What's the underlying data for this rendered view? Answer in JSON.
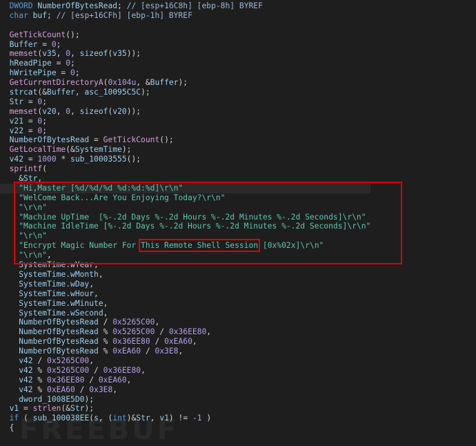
{
  "colors": {
    "background": "#1e1e1e",
    "keyword": "#569cd6",
    "variable": "#9cd0f0",
    "function": "#d8a0dc",
    "number": "#b5a0e8",
    "string": "#5ec8b0",
    "highlight_box": "#e00000"
  },
  "watermark": "FREEBUF",
  "current_line": 19,
  "lines": [
    [
      [
        "t",
        "  DWORD"
      ],
      [
        "o",
        " "
      ],
      [
        "v",
        "NumberOfBytesRead"
      ],
      [
        "o",
        "; "
      ],
      [
        "c",
        "// [esp+16C8h] [ebp-8h] BYREF"
      ]
    ],
    [
      [
        "t",
        "  char"
      ],
      [
        "o",
        " "
      ],
      [
        "v",
        "buf"
      ],
      [
        "o",
        "; "
      ],
      [
        "c",
        "// [esp+16CFh] [ebp-1h] BYREF"
      ]
    ],
    [],
    [
      [
        "f",
        "  GetTickCount"
      ],
      [
        "o",
        "();"
      ]
    ],
    [
      [
        "v",
        "  Buffer"
      ],
      [
        "o",
        " = "
      ],
      [
        "n",
        "0"
      ],
      [
        "o",
        ";"
      ]
    ],
    [
      [
        "f",
        "  memset"
      ],
      [
        "o",
        "("
      ],
      [
        "v",
        "v35"
      ],
      [
        "o",
        ", "
      ],
      [
        "n",
        "0"
      ],
      [
        "o",
        ", "
      ],
      [
        "v",
        "sizeof"
      ],
      [
        "o",
        "("
      ],
      [
        "v",
        "v35"
      ],
      [
        "o",
        "));"
      ]
    ],
    [
      [
        "v",
        "  hReadPipe"
      ],
      [
        "o",
        " = "
      ],
      [
        "n",
        "0"
      ],
      [
        "o",
        ";"
      ]
    ],
    [
      [
        "v",
        "  hWritePipe"
      ],
      [
        "o",
        " = "
      ],
      [
        "n",
        "0"
      ],
      [
        "o",
        ";"
      ]
    ],
    [
      [
        "f",
        "  GetCurrentDirectoryA"
      ],
      [
        "o",
        "("
      ],
      [
        "n",
        "0x104u"
      ],
      [
        "o",
        ", &"
      ],
      [
        "v",
        "Buffer"
      ],
      [
        "o",
        ");"
      ]
    ],
    [
      [
        "v",
        "  strcat"
      ],
      [
        "o",
        "(&"
      ],
      [
        "v",
        "Buffer"
      ],
      [
        "o",
        ", "
      ],
      [
        "v",
        "asc_10095C5C"
      ],
      [
        "o",
        ");"
      ]
    ],
    [
      [
        "v",
        "  Str"
      ],
      [
        "o",
        " = "
      ],
      [
        "n",
        "0"
      ],
      [
        "o",
        ";"
      ]
    ],
    [
      [
        "f",
        "  memset"
      ],
      [
        "o",
        "("
      ],
      [
        "v",
        "v20"
      ],
      [
        "o",
        ", "
      ],
      [
        "n",
        "0"
      ],
      [
        "o",
        ", "
      ],
      [
        "v",
        "sizeof"
      ],
      [
        "o",
        "("
      ],
      [
        "v",
        "v20"
      ],
      [
        "o",
        "));"
      ]
    ],
    [
      [
        "v",
        "  v21"
      ],
      [
        "o",
        " = "
      ],
      [
        "n",
        "0"
      ],
      [
        "o",
        ";"
      ]
    ],
    [
      [
        "v",
        "  v22"
      ],
      [
        "o",
        " = "
      ],
      [
        "n",
        "0"
      ],
      [
        "o",
        ";"
      ]
    ],
    [
      [
        "v",
        "  NumberOfBytesRead"
      ],
      [
        "o",
        " = "
      ],
      [
        "f",
        "GetTickCount"
      ],
      [
        "o",
        "();"
      ]
    ],
    [
      [
        "f",
        "  GetLocalTime"
      ],
      [
        "o",
        "(&"
      ],
      [
        "v",
        "SystemTime"
      ],
      [
        "o",
        ");"
      ]
    ],
    [
      [
        "v",
        "  v42"
      ],
      [
        "o",
        " = "
      ],
      [
        "n",
        "1000"
      ],
      [
        "o",
        " * "
      ],
      [
        "v",
        "sub_10003555"
      ],
      [
        "o",
        "();"
      ]
    ],
    [
      [
        "f",
        "  sprintf"
      ],
      [
        "o",
        "("
      ]
    ],
    [
      [
        "o",
        "    &"
      ],
      [
        "v",
        "Str"
      ],
      [
        "o",
        ","
      ]
    ],
    [
      [
        "s",
        "    \"Hi,Master [%d/%d/%d %d:%d:%d]\\r\\n\""
      ]
    ],
    [
      [
        "s",
        "    \"WelCome Back...Are You Enjoying Today?\\r\\n\""
      ]
    ],
    [
      [
        "s",
        "    \"\\r\\n\""
      ]
    ],
    [
      [
        "s",
        "    \"Machine UpTime  [%-.2d Days %-.2d Hours %-.2d Minutes %-.2d Seconds]\\r\\n\""
      ]
    ],
    [
      [
        "s",
        "    \"Machine IdleTime [%-.2d Days %-.2d Hours %-.2d Minutes %-.2d Seconds]\\r\\n\""
      ]
    ],
    [
      [
        "s",
        "    \"\\r\\n\""
      ]
    ],
    [
      [
        "s",
        "    \"Encrypt Magic Number For "
      ],
      [
        "hl",
        "This Remote Shell Session"
      ],
      [
        "s",
        " [0x%02x]\\r\\n\""
      ]
    ],
    [
      [
        "s",
        "    \"\\r\\n\""
      ],
      [
        "o",
        ","
      ]
    ],
    [
      [
        "v",
        "    SystemTime.wYear"
      ],
      [
        "o",
        ","
      ]
    ],
    [
      [
        "v",
        "    SystemTime.wMonth"
      ],
      [
        "o",
        ","
      ]
    ],
    [
      [
        "v",
        "    SystemTime.wDay"
      ],
      [
        "o",
        ","
      ]
    ],
    [
      [
        "v",
        "    SystemTime.wHour"
      ],
      [
        "o",
        ","
      ]
    ],
    [
      [
        "v",
        "    SystemTime.wMinute"
      ],
      [
        "o",
        ","
      ]
    ],
    [
      [
        "v",
        "    SystemTime.wSecond"
      ],
      [
        "o",
        ","
      ]
    ],
    [
      [
        "v",
        "    NumberOfBytesRead"
      ],
      [
        "o",
        " / "
      ],
      [
        "n",
        "0x5265C00"
      ],
      [
        "o",
        ","
      ]
    ],
    [
      [
        "v",
        "    NumberOfBytesRead"
      ],
      [
        "o",
        " % "
      ],
      [
        "n",
        "0x5265C00"
      ],
      [
        "o",
        " / "
      ],
      [
        "n",
        "0x36EE80"
      ],
      [
        "o",
        ","
      ]
    ],
    [
      [
        "v",
        "    NumberOfBytesRead"
      ],
      [
        "o",
        " % "
      ],
      [
        "n",
        "0x36EE80"
      ],
      [
        "o",
        " / "
      ],
      [
        "n",
        "0xEA60"
      ],
      [
        "o",
        ","
      ]
    ],
    [
      [
        "v",
        "    NumberOfBytesRead"
      ],
      [
        "o",
        " % "
      ],
      [
        "n",
        "0xEA60"
      ],
      [
        "o",
        " / "
      ],
      [
        "n",
        "0x3E8"
      ],
      [
        "o",
        ","
      ]
    ],
    [
      [
        "v",
        "    v42"
      ],
      [
        "o",
        " / "
      ],
      [
        "n",
        "0x5265C00"
      ],
      [
        "o",
        ","
      ]
    ],
    [
      [
        "v",
        "    v42"
      ],
      [
        "o",
        " % "
      ],
      [
        "n",
        "0x5265C00"
      ],
      [
        "o",
        " / "
      ],
      [
        "n",
        "0x36EE80"
      ],
      [
        "o",
        ","
      ]
    ],
    [
      [
        "v",
        "    v42"
      ],
      [
        "o",
        " % "
      ],
      [
        "n",
        "0x36EE80"
      ],
      [
        "o",
        " / "
      ],
      [
        "n",
        "0xEA60"
      ],
      [
        "o",
        ","
      ]
    ],
    [
      [
        "v",
        "    v42"
      ],
      [
        "o",
        " % "
      ],
      [
        "n",
        "0xEA60"
      ],
      [
        "o",
        " / "
      ],
      [
        "n",
        "0x3E8"
      ],
      [
        "o",
        ","
      ]
    ],
    [
      [
        "v",
        "    dword_1008E5D0"
      ],
      [
        "o",
        ");"
      ]
    ],
    [
      [
        "v",
        "  v1"
      ],
      [
        "o",
        " = "
      ],
      [
        "f",
        "strlen"
      ],
      [
        "o",
        "(&"
      ],
      [
        "v",
        "Str"
      ],
      [
        "o",
        ");"
      ]
    ],
    [
      [
        "k",
        "  if"
      ],
      [
        "o",
        " ( "
      ],
      [
        "v",
        "sub_100038EE"
      ],
      [
        "o",
        "("
      ],
      [
        "v",
        "s"
      ],
      [
        "o",
        ", ("
      ],
      [
        "k",
        "int"
      ],
      [
        "o",
        ")&"
      ],
      [
        "v",
        "Str"
      ],
      [
        "o",
        ", "
      ],
      [
        "v",
        "v1"
      ],
      [
        "o",
        ") != "
      ],
      [
        "n",
        "-1"
      ],
      [
        "o",
        " )"
      ]
    ],
    [
      [
        "o",
        "  {"
      ]
    ]
  ]
}
